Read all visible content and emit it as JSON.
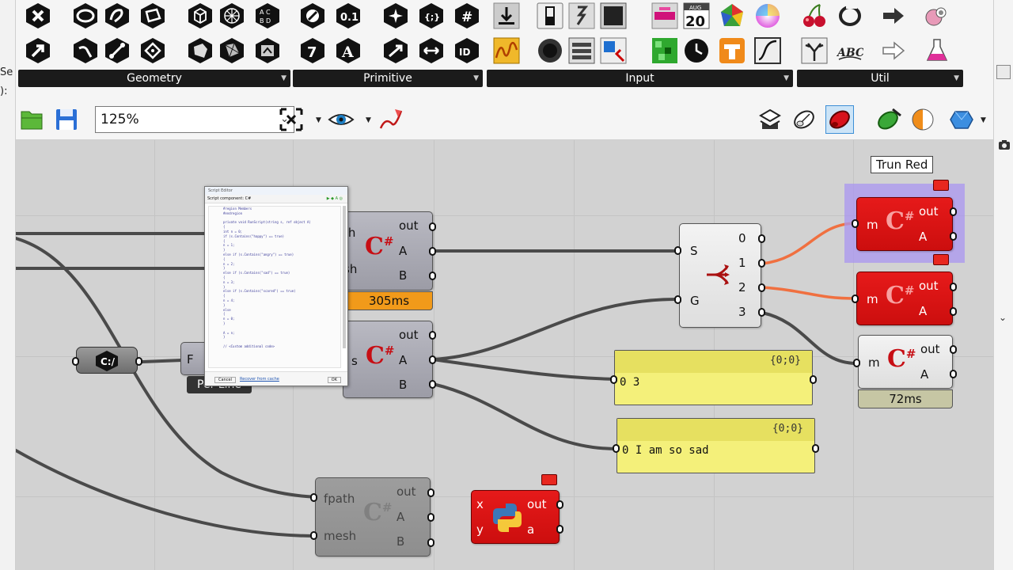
{
  "ribbon": {
    "groups": [
      {
        "label": "Geometry"
      },
      {
        "label": "Primitive"
      },
      {
        "label": "Input"
      },
      {
        "label": "Util"
      }
    ],
    "calendar": {
      "month": "AUG",
      "day": "20"
    }
  },
  "toolbar": {
    "zoom": "125%"
  },
  "left_strip_text": {
    "top": "Se",
    "mid": "):"
  },
  "canvas": {
    "script_top": {
      "inputs": [
        "th",
        "sh"
      ],
      "outputs": [
        "out",
        "A",
        "B"
      ],
      "timer": "305ms"
    },
    "script_mid": {
      "inputs": [
        "s"
      ],
      "outputs": [
        "out",
        "A",
        "B"
      ]
    },
    "script_bottom": {
      "inputs": [
        "fpath",
        "mesh"
      ],
      "outputs": [
        "out",
        "A",
        "B"
      ]
    },
    "python": {
      "inputs": [
        "x",
        "y"
      ],
      "outputs": [
        "out",
        "a"
      ]
    },
    "stream": {
      "inputs": [
        "S",
        "G"
      ],
      "outputs": [
        "0",
        "1",
        "2",
        "3"
      ]
    },
    "red_top": {
      "inputs": [
        "m"
      ],
      "outputs": [
        "out",
        "A"
      ]
    },
    "red_mid": {
      "inputs": [
        "m"
      ],
      "outputs": [
        "out",
        "A"
      ]
    },
    "white_right": {
      "inputs": [
        "m"
      ],
      "outputs": [
        "out",
        "A"
      ],
      "timer": "72ms"
    },
    "tooltip": "Trun Red",
    "panel_1": {
      "header": "{0;0}",
      "index": "0",
      "value": "3"
    },
    "panel_2": {
      "header": "{0;0}",
      "index": "0",
      "value": "I am so sad"
    },
    "file_param": {
      "label": "F",
      "name": "Per Line"
    },
    "editor_popup": {
      "title": "Script Editor",
      "subtitle": "Script component: C#",
      "code": [
        "#region Members",
        "#endregion",
        "",
        "private void RunScript(string s, ref object A)",
        "{",
        "  int n = 0;",
        "  if (s.Contains(\"happy\") == true)",
        "  {",
        "    n = 1;",
        "  }",
        "  else if (s.Contains(\"angry\") == true)",
        "  {",
        "    n = 2;",
        "  }",
        "  else if (s.Contains(\"sad\") == true)",
        "  {",
        "    n = 3;",
        "  }",
        "  else if (s.Contains(\"scared\") == true)",
        "  {",
        "    n = 4;",
        "  }",
        "  else",
        "  {",
        "    n = 0;",
        "  }",
        "",
        "  A = n;",
        "}",
        "",
        "// <Custom additional code>"
      ],
      "footer": {
        "cancel": "Cancel",
        "recover": "Recover from cache",
        "ok": "OK"
      }
    }
  }
}
